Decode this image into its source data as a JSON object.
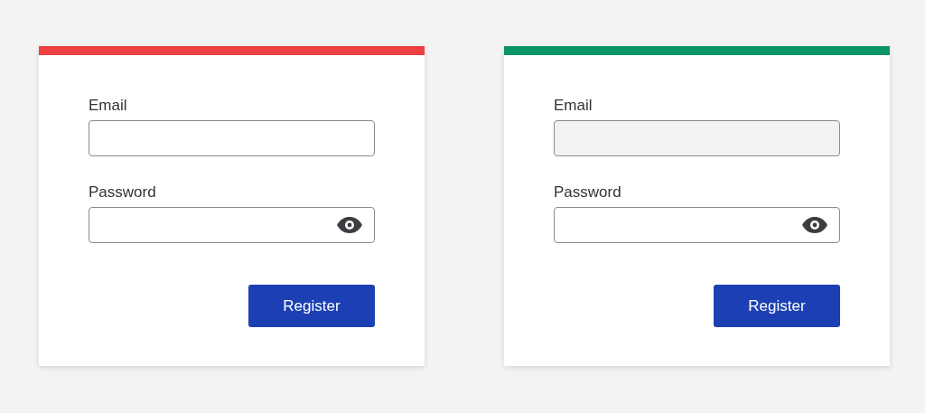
{
  "cards": [
    {
      "color": "#ee4042",
      "fields": [
        {
          "kind": "text",
          "label": "Email",
          "shaded": false
        },
        {
          "kind": "password",
          "label": "Password",
          "shaded": false
        }
      ],
      "button": "Register"
    },
    {
      "color": "#0a9467",
      "fields": [
        {
          "kind": "text",
          "label": "Email",
          "shaded": true
        },
        {
          "kind": "password",
          "label": "Password",
          "shaded": false
        }
      ],
      "button": "Register"
    }
  ]
}
